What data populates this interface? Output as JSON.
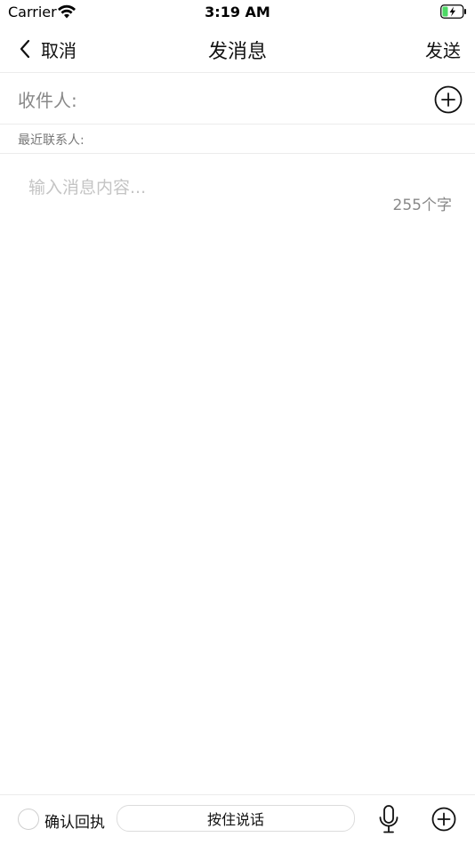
{
  "status_bar": {
    "carrier": "Carrier",
    "time": "3:19 AM",
    "wifi_icon": "wifi-icon",
    "battery_icon": "battery-charging-icon",
    "battery_color": "#4cd964"
  },
  "nav": {
    "back_label": "取消",
    "back_icon": "chevron-left-icon",
    "title": "发消息",
    "send_label": "发送"
  },
  "recipient": {
    "label": "收件人:",
    "add_icon": "plus-circle-icon"
  },
  "recent": {
    "label": "最近联系人:"
  },
  "message": {
    "placeholder": "输入消息内容...",
    "value": "",
    "char_count": "255个字"
  },
  "bottom_bar": {
    "receipt_label": "确认回执",
    "receipt_checked": false,
    "hold_to_talk_label": "按住说话",
    "mic_icon": "microphone-icon",
    "more_icon": "plus-circle-icon"
  }
}
